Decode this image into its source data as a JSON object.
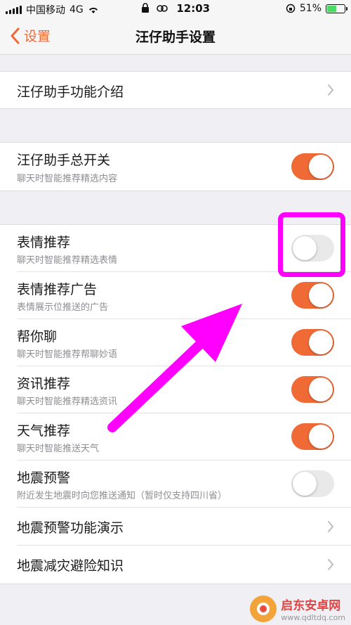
{
  "status_bar": {
    "carrier": "中国移动",
    "network": "4G",
    "time": "12:03",
    "battery_percent": "51%",
    "battery_level": 0.51
  },
  "nav": {
    "back_label": "设置",
    "title": "汪仔助手设置"
  },
  "group1": {
    "intro": "汪仔助手功能介绍"
  },
  "group2": {
    "master_title": "汪仔助手总开关",
    "master_sub": "聊天时智能推荐精选内容",
    "master_on": true
  },
  "group3": {
    "items": [
      {
        "title": "表情推荐",
        "sub": "聊天时智能推荐精选表情",
        "on": false
      },
      {
        "title": "表情推荐广告",
        "sub": "表情展示位推送的广告",
        "on": true
      },
      {
        "title": "帮你聊",
        "sub": "聊天时智能推荐帮聊妙语",
        "on": true
      },
      {
        "title": "资讯推荐",
        "sub": "聊天时智能推荐精选资讯",
        "on": true
      },
      {
        "title": "天气推荐",
        "sub": "聊天时智能推送天气",
        "on": true
      },
      {
        "title": "地震预警",
        "sub": "附近发生地震时向您推送通知（暂时仅支持四川省）",
        "on": false
      }
    ],
    "links": [
      {
        "title": "地震预警功能演示"
      },
      {
        "title": "地震减灾避险知识"
      }
    ]
  },
  "colors": {
    "accent": "#f06a35",
    "annotation": "#ff00ff"
  },
  "watermark": {
    "name": "启东安卓网",
    "url": "www.qdltdq.com"
  }
}
